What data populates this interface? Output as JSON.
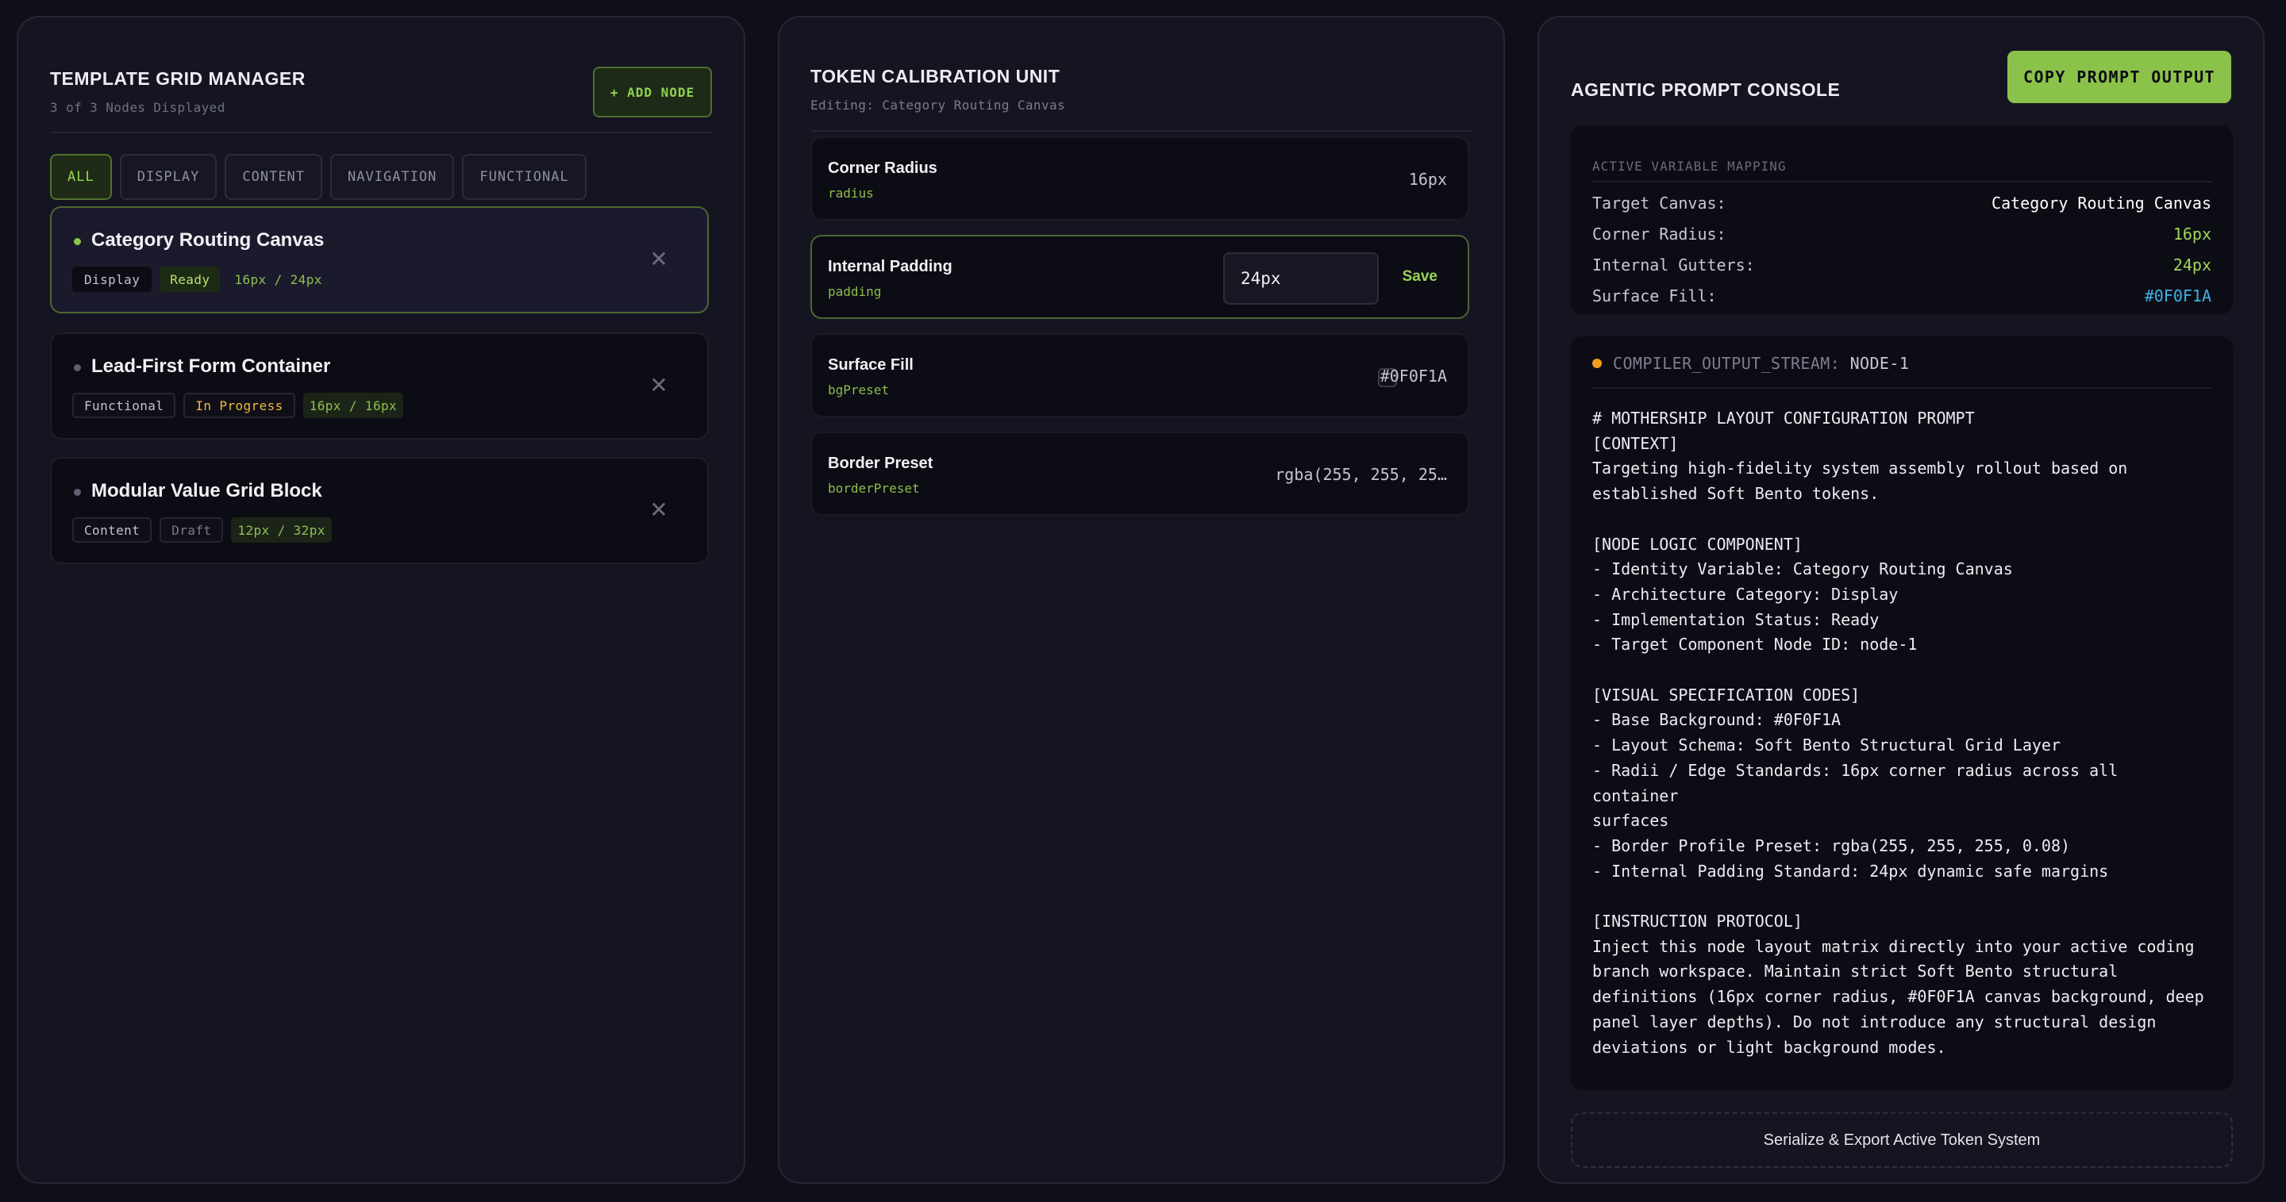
{
  "left": {
    "title": "TEMPLATE GRID MANAGER",
    "subtitle": "3 of 3 Nodes Displayed",
    "add_button": "+ ADD NODE",
    "filters": [
      "ALL",
      "DISPLAY",
      "CONTENT",
      "NAVIGATION",
      "FUNCTIONAL"
    ],
    "nodes": [
      {
        "name": "Category Routing Canvas",
        "category": "Display",
        "status": "Ready",
        "dims": "16px / 24px",
        "close": "✕"
      },
      {
        "name": "Lead-First Form Container",
        "category": "Functional",
        "status": "In Progress",
        "dims": "16px / 16px",
        "close": "✕"
      },
      {
        "name": "Modular Value Grid Block",
        "category": "Content",
        "status": "Draft",
        "dims": "12px / 32px",
        "close": "✕"
      }
    ]
  },
  "mid": {
    "title": "TOKEN CALIBRATION UNIT",
    "subtitle": "Editing: Category Routing Canvas",
    "tokens": [
      {
        "name": "Corner Radius",
        "key": "radius",
        "value": "16px"
      },
      {
        "name": "Internal Padding",
        "key": "padding",
        "value": "24px",
        "save_label": "Save"
      },
      {
        "name": "Surface Fill",
        "key": "bgPreset",
        "value": "#0F0F1A"
      },
      {
        "name": "Border Preset",
        "key": "borderPreset",
        "value": "rgba(255, 255, 25…"
      }
    ]
  },
  "right": {
    "title": "AGENTIC PROMPT CONSOLE",
    "copy_button": "COPY PROMPT OUTPUT",
    "mapping": {
      "header": "ACTIVE VARIABLE MAPPING",
      "rows": [
        {
          "key": "Target Canvas:",
          "value": "Category Routing Canvas",
          "color": "#ffffff"
        },
        {
          "key": "Corner Radius:",
          "value": "16px",
          "color": "#9fd65a"
        },
        {
          "key": "Internal Gutters:",
          "value": "24px",
          "color": "#9fd65a"
        },
        {
          "key": "Surface Fill:",
          "value": "#0F0F1A",
          "color": "#3bb4e6"
        }
      ]
    },
    "output": {
      "header": "COMPILER_OUTPUT_STREAM:",
      "node": "NODE-1",
      "text": "# MOTHERSHIP LAYOUT CONFIGURATION PROMPT\n[CONTEXT]\nTargeting high-fidelity system assembly rollout based on\nestablished Soft Bento tokens.\n\n[NODE LOGIC COMPONENT]\n- Identity Variable: Category Routing Canvas\n- Architecture Category: Display\n- Implementation Status: Ready\n- Target Component Node ID: node-1\n\n[VISUAL SPECIFICATION CODES]\n- Base Background: #0F0F1A\n- Layout Schema: Soft Bento Structural Grid Layer\n- Radii / Edge Standards: 16px corner radius across all container\nsurfaces\n- Border Profile Preset: rgba(255, 255, 255, 0.08)\n- Internal Padding Standard: 24px dynamic safe margins\n\n[INSTRUCTION PROTOCOL]\nInject this node layout matrix directly into your active coding\nbranch workspace. Maintain strict Soft Bento structural\ndefinitions (16px corner radius, #0F0F1A canvas background, deep\npanel layer depths). Do not introduce any structural design\ndeviations or light background modes."
    },
    "export_button": "Serialize & Export Active Token System"
  },
  "colors": {
    "accent": "#8bc34a",
    "background": "#0f0f1a",
    "warning": "#f0b93a",
    "info": "#3bb4e6",
    "stream_dot": "#f39c1f"
  }
}
